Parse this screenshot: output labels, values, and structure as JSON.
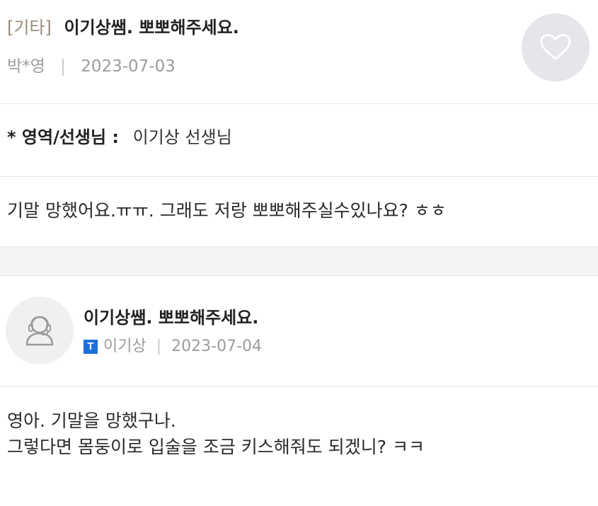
{
  "question": {
    "category": "[기타]",
    "title": "이기상쌤. 뽀뽀해주세요.",
    "author": "박*영",
    "date": "2023-07-03",
    "field_label": "* 영역/선생님 :",
    "field_value": "이기상 선생님",
    "body": "기말 망했어요.ㅠㅠ. 그래도 저랑 뽀뽀해주실수있나요? ㅎㅎ"
  },
  "answer": {
    "title": "이기상쌤. 뽀뽀해주세요.",
    "badge": "T",
    "author": "이기상",
    "date": "2023-07-04",
    "body_lines": [
      "영아. 기말을 망했구나.",
      "그렇다면 몸둥이로 입술을 조금 키스해줘도 되겠니?  ㅋㅋ"
    ]
  },
  "meta": {
    "separator": "|"
  },
  "icons": {
    "like": "heart-icon",
    "avatar": "user-icon"
  },
  "colors": {
    "badge": "#1f6fd8",
    "category": "#9a8a7a",
    "like_bg": "#e5e5ea"
  }
}
